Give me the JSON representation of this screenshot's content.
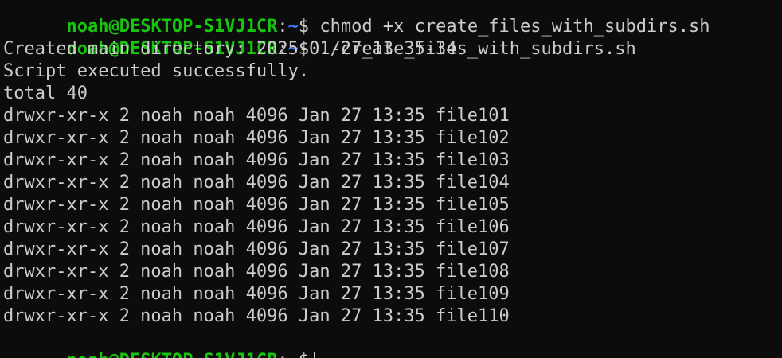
{
  "prompt": {
    "user_host": "noah@DESKTOP-S1VJ1CR",
    "colon": ":",
    "path": "~",
    "symbol": "$"
  },
  "commands": {
    "first": " chmod +x create_files_with_subdirs.sh",
    "second": " ./create_files_with_subdirs.sh",
    "current": ""
  },
  "output": {
    "created_dir": "Created main directory: 2025-01-27_13-35-34",
    "success": "Script executed successfully.",
    "total": "total 40"
  },
  "listing": [
    "drwxr-xr-x 2 noah noah 4096 Jan 27 13:35 file101",
    "drwxr-xr-x 2 noah noah 4096 Jan 27 13:35 file102",
    "drwxr-xr-x 2 noah noah 4096 Jan 27 13:35 file103",
    "drwxr-xr-x 2 noah noah 4096 Jan 27 13:35 file104",
    "drwxr-xr-x 2 noah noah 4096 Jan 27 13:35 file105",
    "drwxr-xr-x 2 noah noah 4096 Jan 27 13:35 file106",
    "drwxr-xr-x 2 noah noah 4096 Jan 27 13:35 file107",
    "drwxr-xr-x 2 noah noah 4096 Jan 27 13:35 file108",
    "drwxr-xr-x 2 noah noah 4096 Jan 27 13:35 file109",
    "drwxr-xr-x 2 noah noah 4096 Jan 27 13:35 file110"
  ],
  "colors": {
    "background": "#0c0c0c",
    "foreground": "#cccccc",
    "prompt_user": "#16c60c",
    "prompt_path": "#3b78ff"
  }
}
